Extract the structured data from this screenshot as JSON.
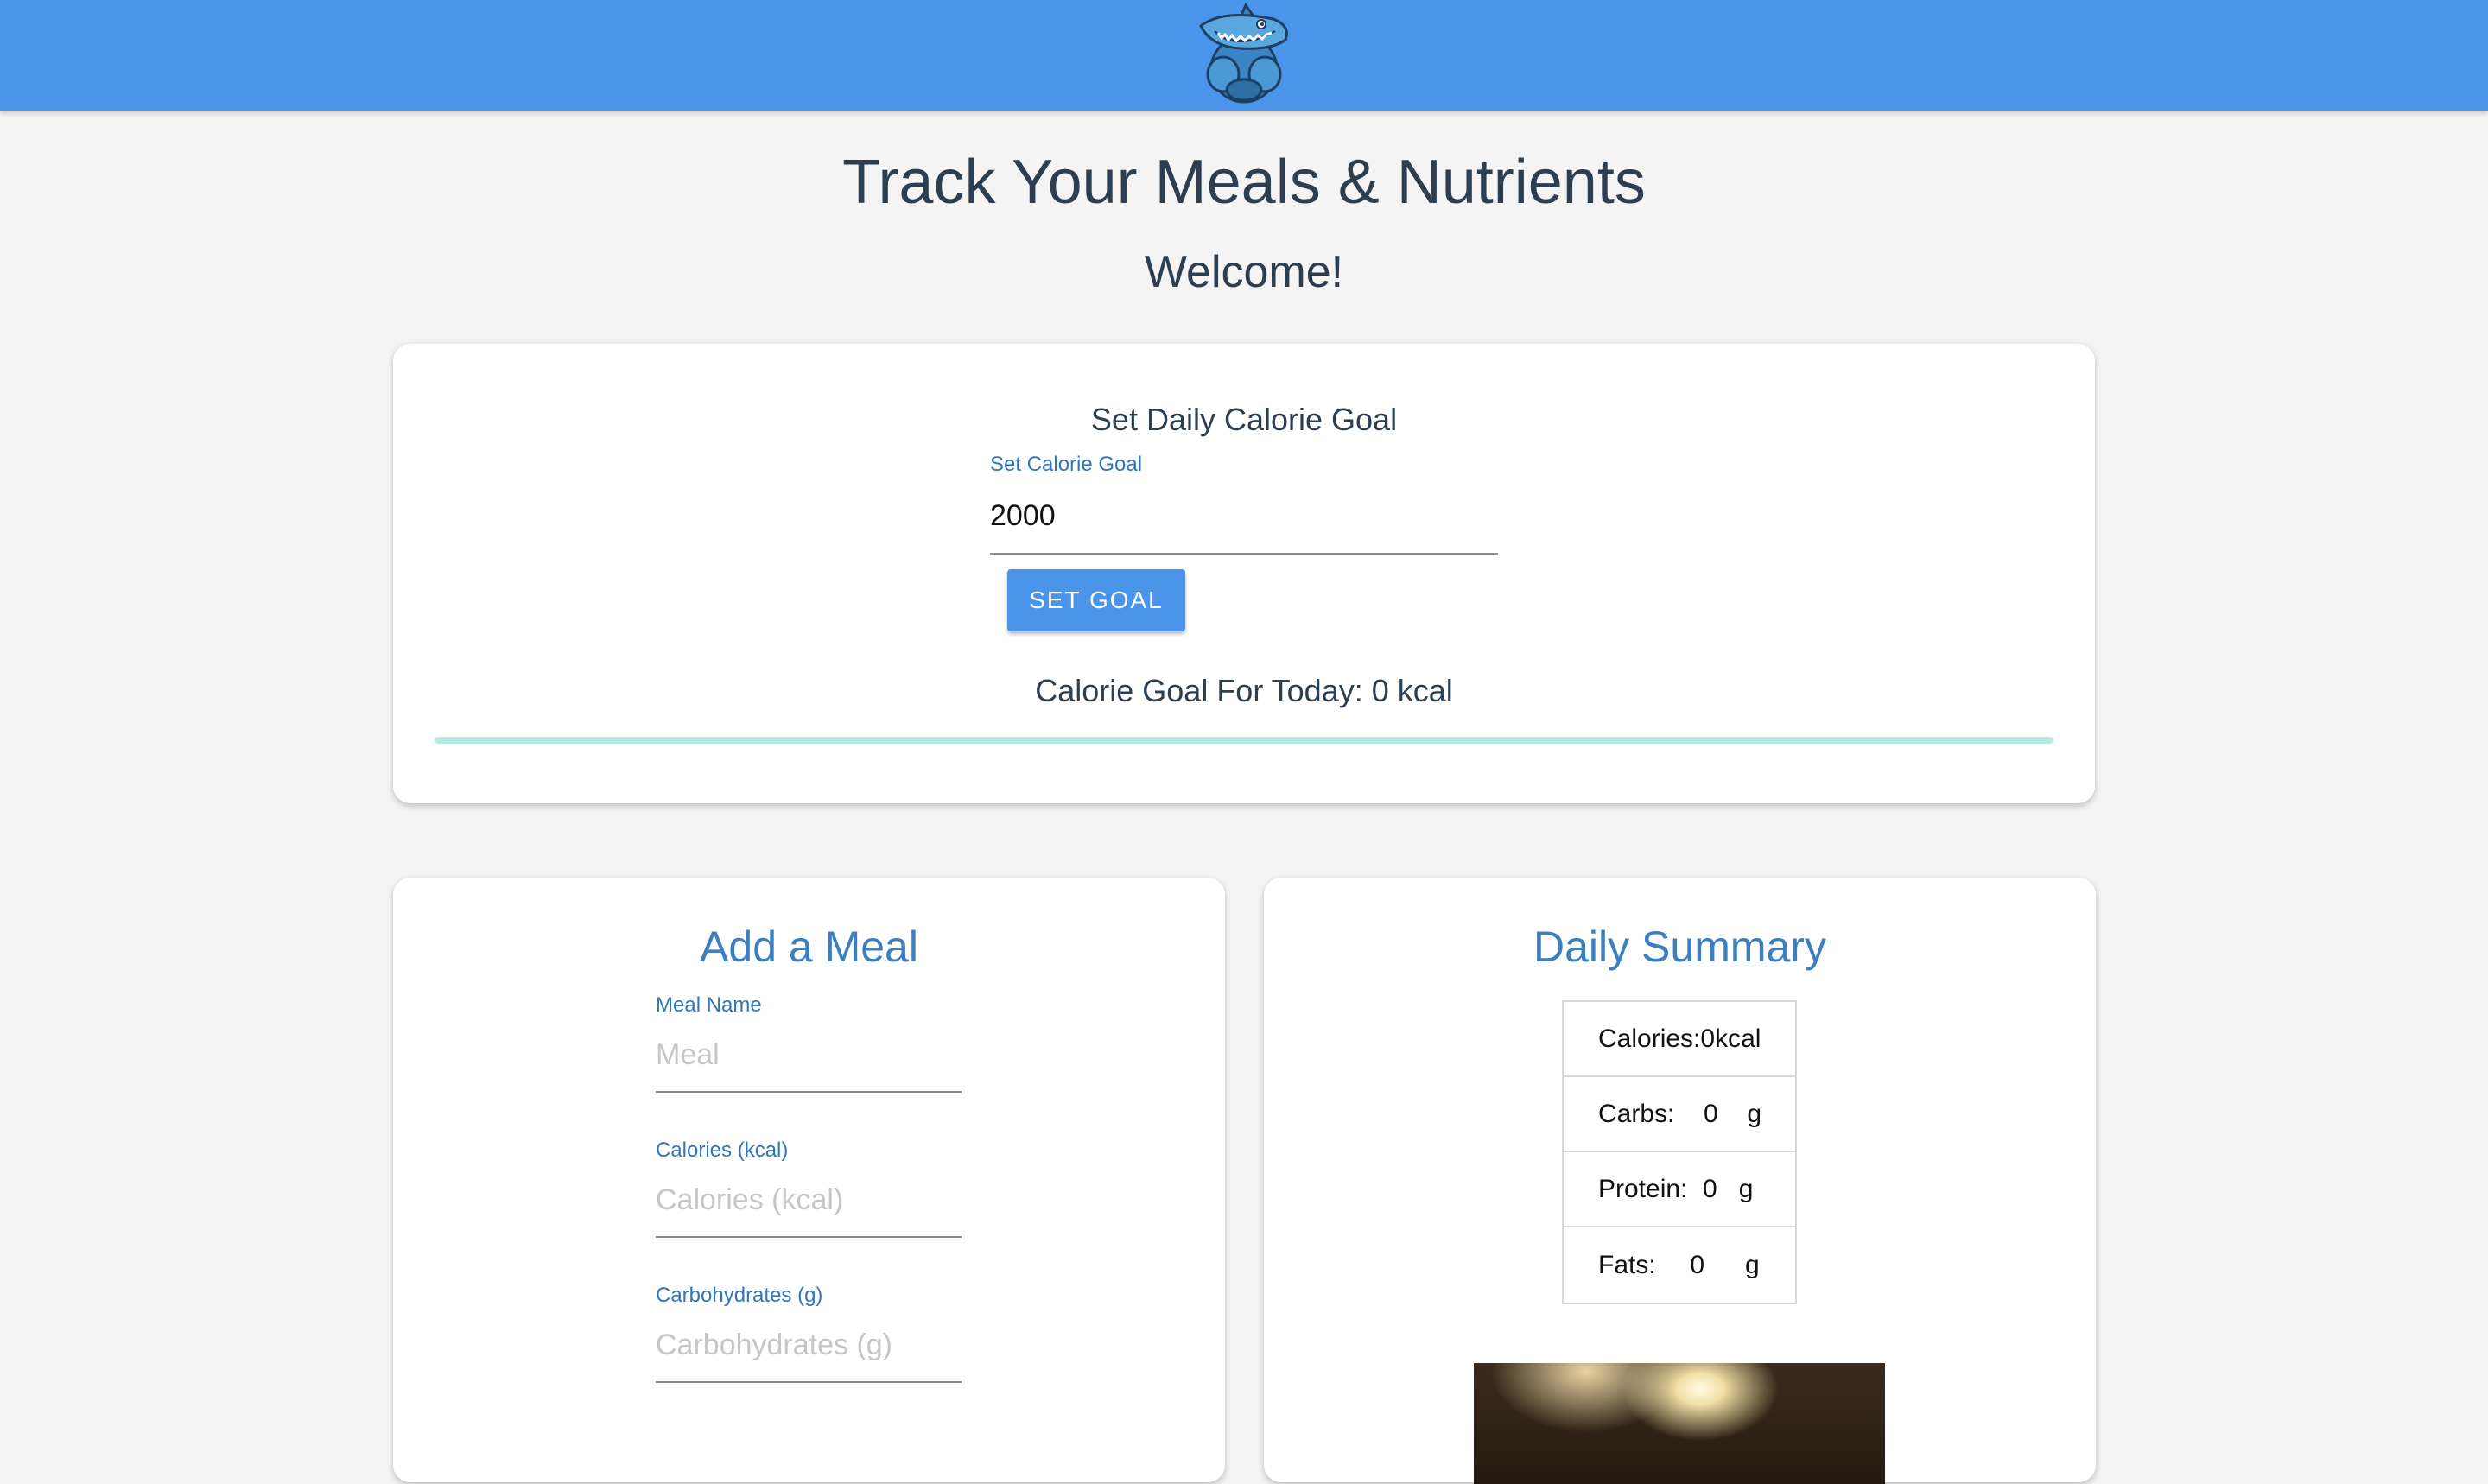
{
  "header": {
    "logo_icon": "shark-mascot-logo",
    "background_color": "#4a94ea"
  },
  "page": {
    "title": "Track Your Meals & Nutrients",
    "welcome": "Welcome!"
  },
  "goal_card": {
    "heading": "Set Daily Calorie Goal",
    "field_label": "Set Calorie Goal",
    "field_value": "2000",
    "button_label": "SET GOAL",
    "status_text": "Calorie Goal For Today: 0 kcal",
    "progress_fraction": 0
  },
  "meal_card": {
    "title": "Add a Meal",
    "fields": [
      {
        "label": "Meal Name",
        "placeholder": "Meal"
      },
      {
        "label": "Calories (kcal)",
        "placeholder": "Calories (kcal)"
      },
      {
        "label": "Carbohydrates (g)",
        "placeholder": "Carbohydrates (g)"
      }
    ]
  },
  "summary_card": {
    "title": "Daily Summary",
    "rows": [
      {
        "label": "Calories:",
        "value": "0",
        "unit": "kcal"
      },
      {
        "label": "Carbs:",
        "value": "0",
        "unit": "g"
      },
      {
        "label": "Protein:",
        "value": "0",
        "unit": "g"
      },
      {
        "label": "Fats:",
        "value": "0",
        "unit": "g"
      }
    ]
  },
  "colors": {
    "accent": "#4a94ea",
    "label_blue": "#2f77bd",
    "title_blue": "#3b7fc0",
    "progress_track": "#b7ebe1"
  }
}
